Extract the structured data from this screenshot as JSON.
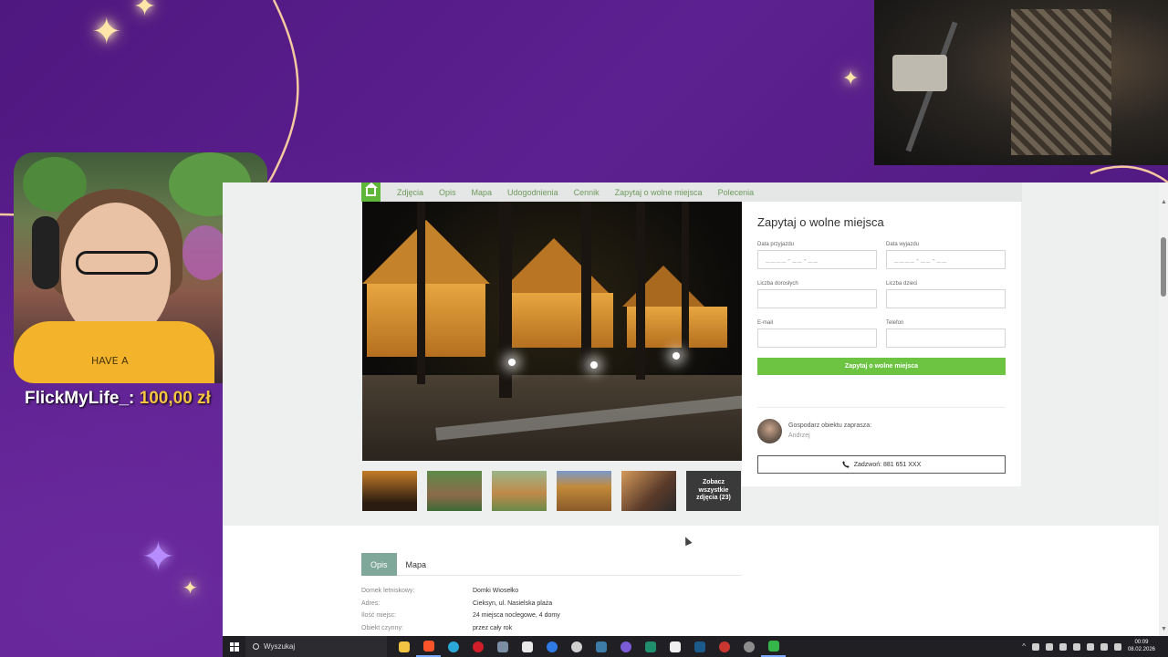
{
  "colors": {
    "accent_green": "#6cc442",
    "nav_link": "#6f9a5e",
    "tab_active": "#7fa89a",
    "stream_purple": "#5b1e8c",
    "donation_gold": "#f5c542"
  },
  "overlay": {
    "donation_name": "FlickMyLife_:",
    "donation_amount": "100,00 zł",
    "shirt_text": "HAVE A"
  },
  "site": {
    "home_icon": "home-icon",
    "nav": [
      "Zdjęcia",
      "Opis",
      "Mapa",
      "Udogodnienia",
      "Cennik",
      "Zapytaj o wolne miejsca",
      "Polecenia"
    ],
    "gallery": {
      "more_label": "Zobacz wszystkie zdjęcia (23)"
    },
    "form": {
      "title": "Zapytaj o wolne miejsca",
      "arrival_label": "Data przyjazdu",
      "arrival_placeholder": "____-__-__",
      "departure_label": "Data wyjazdu",
      "departure_placeholder": "____-__-__",
      "adults_label": "Liczba dorosłych",
      "children_label": "Liczba dzieci",
      "email_label": "E-mail",
      "phone_label": "Telefon",
      "submit_label": "Zapytaj o wolne miejsca"
    },
    "host": {
      "label": "Gospodarz obiektu zaprasza:",
      "name": "Andrzej",
      "call_label": "Zadzwoń: 881 651 XXX"
    },
    "tabs": [
      {
        "label": "Opis",
        "active": true
      },
      {
        "label": "Mapa",
        "active": false
      }
    ],
    "description": [
      {
        "label": "Domek letniskowy:",
        "value": "Domki Wiosełko"
      },
      {
        "label": "Adres:",
        "value": "Cieksyn, ul. Nasielska plaża"
      },
      {
        "label": "Ilość miejsc:",
        "value": "24 miejsca noclegowe, 4 domy"
      },
      {
        "label": "Obiekt czynny:",
        "value": "przez cały rok"
      }
    ]
  },
  "taskbar": {
    "search_placeholder": "Wyszukaj",
    "time": "00:09",
    "date": "08.02.2026",
    "apps": [
      "file-explorer-icon",
      "brave-icon",
      "edge-icon",
      "opera-icon",
      "app-icon",
      "epic-games-icon",
      "app-icon",
      "obs-icon",
      "steam-icon",
      "discord-icon",
      "app-icon",
      "app-icon",
      "steam-icon",
      "app-icon",
      "app-icon",
      "app-icon"
    ]
  }
}
